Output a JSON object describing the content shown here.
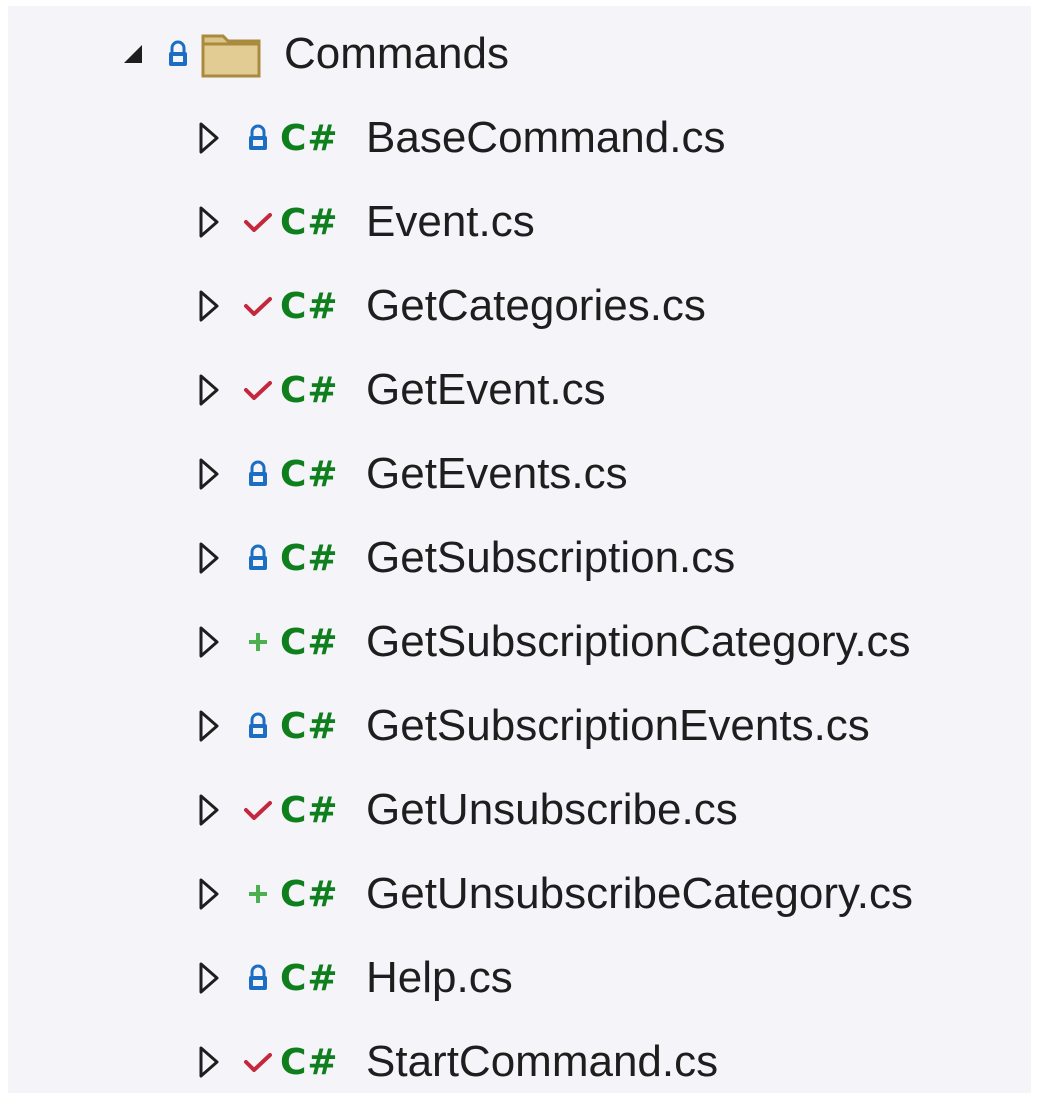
{
  "tree": {
    "folder": {
      "name": "Commands",
      "status": "lock-icon",
      "icon": "folder-icon",
      "expanded": true
    },
    "file_icon_text": "C#",
    "colors": {
      "lock": "#1b6ec2",
      "check": "#c4283d",
      "plus": "#4caf50",
      "csharp": "#0f7f1e",
      "folder_fill": "#dcc488",
      "folder_border": "#a98a3e"
    },
    "files": [
      {
        "name": "BaseCommand.cs",
        "status": "lock-icon"
      },
      {
        "name": "Event.cs",
        "status": "checkmark-icon"
      },
      {
        "name": "GetCategories.cs",
        "status": "checkmark-icon"
      },
      {
        "name": "GetEvent.cs",
        "status": "checkmark-icon"
      },
      {
        "name": "GetEvents.cs",
        "status": "lock-icon"
      },
      {
        "name": "GetSubscription.cs",
        "status": "lock-icon"
      },
      {
        "name": "GetSubscriptionCategory.cs",
        "status": "plus-icon"
      },
      {
        "name": "GetSubscriptionEvents.cs",
        "status": "lock-icon"
      },
      {
        "name": "GetUnsubscribe.cs",
        "status": "checkmark-icon"
      },
      {
        "name": "GetUnsubscribeCategory.cs",
        "status": "plus-icon"
      },
      {
        "name": "Help.cs",
        "status": "lock-icon"
      },
      {
        "name": "StartCommand.cs",
        "status": "checkmark-icon"
      }
    ]
  }
}
